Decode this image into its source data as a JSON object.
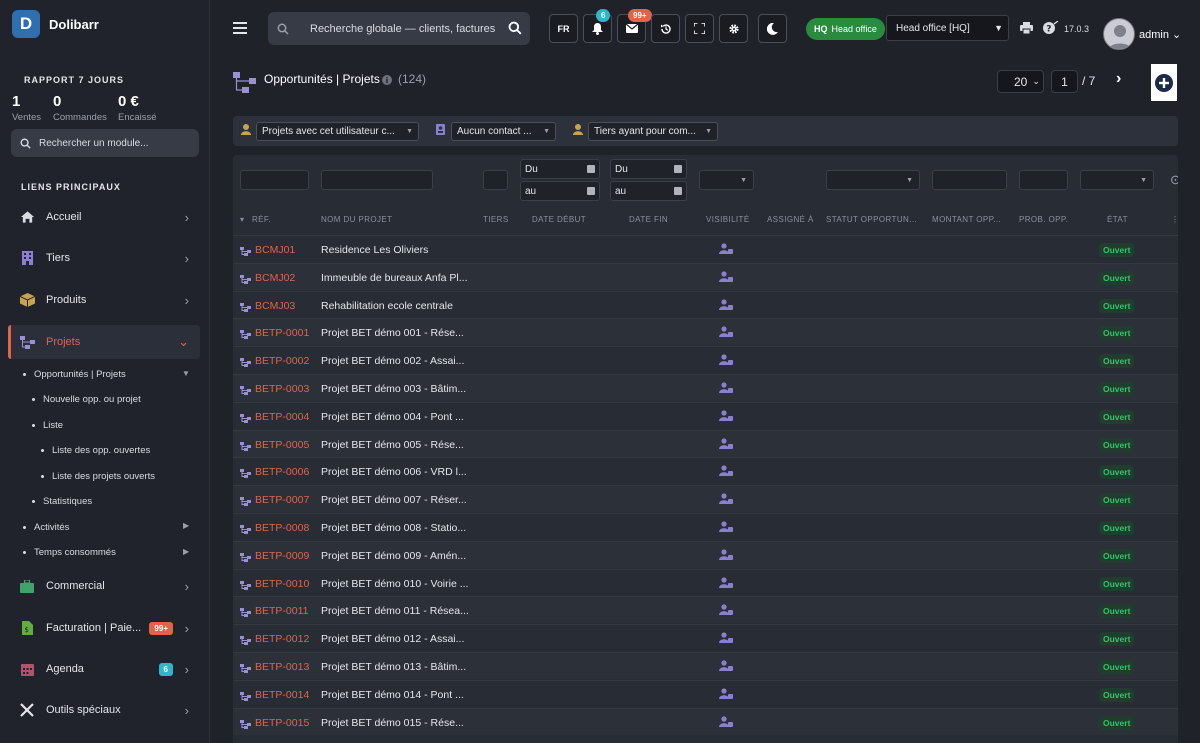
{
  "brand": {
    "name": "Dolibarr",
    "logo_letter": "D"
  },
  "report": {
    "title": "RAPPORT 7 JOURS",
    "stats": [
      {
        "value": "1",
        "label": "Ventes"
      },
      {
        "value": "0",
        "label": "Commandes"
      },
      {
        "value": "0 €",
        "label": "Encaissé"
      }
    ]
  },
  "module_search": {
    "placeholder": "Rechercher un module..."
  },
  "sidebar": {
    "section_title": "LIENS PRINCIPAUX",
    "items": [
      {
        "label": "Accueil",
        "icon": "home-icon"
      },
      {
        "label": "Tiers",
        "icon": "building-icon"
      },
      {
        "label": "Produits",
        "icon": "box-icon"
      },
      {
        "label": "Projets",
        "icon": "project-icon",
        "active": true
      },
      {
        "label": "Commercial",
        "icon": "briefcase-icon"
      },
      {
        "label": "Facturation | Paie...",
        "icon": "invoice-icon",
        "badge": "99+"
      },
      {
        "label": "Agenda",
        "icon": "calendar-icon",
        "badge": "6"
      },
      {
        "label": "Outils spéciaux",
        "icon": "tools-icon"
      }
    ],
    "subitems": [
      "Opportunités | Projets",
      "Nouvelle opp. ou projet",
      "Liste",
      "Liste des opp. ouvertes",
      "Liste des projets ouverts",
      "Statistiques",
      "Activités",
      "Temps consommés"
    ]
  },
  "topbar": {
    "search_placeholder": "Recherche globale — clients, factures",
    "lang": "FR",
    "notif_count": "6",
    "mail_count": "99+",
    "company_badge_code": "HQ",
    "company_badge_label": "Head office",
    "entity_select": "Head office [HQ]",
    "version": "17.0.3",
    "user": "admin"
  },
  "page": {
    "title": "Opportunités | Projets",
    "count": "(124)",
    "page_size": "20",
    "page_current": "1",
    "page_total": "/  7"
  },
  "filters": [
    "Projets avec cet utilisateur c...",
    "Aucun contact ...",
    "Tiers ayant pour com..."
  ],
  "date_filters": {
    "from": "Du",
    "to": "au"
  },
  "columns": [
    "RÉF.",
    "NOM DU PROJET",
    "TIERS",
    "DATE DÉBUT",
    "DATE FIN",
    "VISIBILITÉ",
    "ASSIGNÉ À",
    "STATUT OPPORTUN...",
    "MONTANT OPP...",
    "PROB. OPP.",
    "ÉTAT"
  ],
  "rows": [
    {
      "ref": "BCMJ01",
      "name": "Residence Les Oliviers",
      "status": "Ouvert"
    },
    {
      "ref": "BCMJ02",
      "name": "Immeuble de bureaux Anfa Pl...",
      "status": "Ouvert"
    },
    {
      "ref": "BCMJ03",
      "name": "Rehabilitation ecole centrale",
      "status": "Ouvert"
    },
    {
      "ref": "BETP-0001",
      "name": "Projet BET démo 001 - Rése...",
      "status": "Ouvert"
    },
    {
      "ref": "BETP-0002",
      "name": "Projet BET démo 002 - Assai...",
      "status": "Ouvert"
    },
    {
      "ref": "BETP-0003",
      "name": "Projet BET démo 003 - Bâtim...",
      "status": "Ouvert"
    },
    {
      "ref": "BETP-0004",
      "name": "Projet BET démo 004 - Pont ...",
      "status": "Ouvert"
    },
    {
      "ref": "BETP-0005",
      "name": "Projet BET démo 005 - Rése...",
      "status": "Ouvert"
    },
    {
      "ref": "BETP-0006",
      "name": "Projet BET démo 006 - VRD l...",
      "status": "Ouvert"
    },
    {
      "ref": "BETP-0007",
      "name": "Projet BET démo 007 - Réser...",
      "status": "Ouvert"
    },
    {
      "ref": "BETP-0008",
      "name": "Projet BET démo 008 - Statio...",
      "status": "Ouvert"
    },
    {
      "ref": "BETP-0009",
      "name": "Projet BET démo 009 - Amén...",
      "status": "Ouvert"
    },
    {
      "ref": "BETP-0010",
      "name": "Projet BET démo 010 - Voirie ...",
      "status": "Ouvert"
    },
    {
      "ref": "BETP-0011",
      "name": "Projet BET démo 011 - Résea...",
      "status": "Ouvert"
    },
    {
      "ref": "BETP-0012",
      "name": "Projet BET démo 012 - Assai...",
      "status": "Ouvert"
    },
    {
      "ref": "BETP-0013",
      "name": "Projet BET démo 013 - Bâtim...",
      "status": "Ouvert"
    },
    {
      "ref": "BETP-0014",
      "name": "Projet BET démo 014 - Pont ...",
      "status": "Ouvert"
    },
    {
      "ref": "BETP-0015",
      "name": "Projet BET démo 015 - Rése...",
      "status": "Ouvert"
    }
  ],
  "colors": {
    "accent": "#e2634a",
    "status_green": "#36c26a",
    "badge_red": "#e2634a",
    "badge_teal": "#2fb6c9",
    "hq_green": "#2a8a3e"
  }
}
